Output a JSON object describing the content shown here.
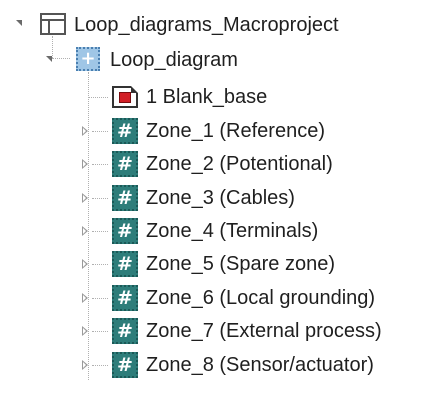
{
  "tree": {
    "root": {
      "label": "Loop_diagrams_Macroproject",
      "icon": "window-icon"
    },
    "child": {
      "label": "Loop_diagram",
      "icon": "plus-folder-icon",
      "icon_glyph": "+"
    },
    "items": [
      {
        "label": "1 Blank_base",
        "icon": "document-icon",
        "expandable": false
      },
      {
        "label": "Zone_1 (Reference)",
        "icon": "hash-icon",
        "expandable": true
      },
      {
        "label": "Zone_2 (Potentional)",
        "icon": "hash-icon",
        "expandable": true
      },
      {
        "label": "Zone_3 (Cables)",
        "icon": "hash-icon",
        "expandable": true
      },
      {
        "label": "Zone_4 (Terminals)",
        "icon": "hash-icon",
        "expandable": true
      },
      {
        "label": "Zone_5 (Spare zone)",
        "icon": "hash-icon",
        "expandable": true
      },
      {
        "label": "Zone_6 (Local grounding)",
        "icon": "hash-icon",
        "expandable": true
      },
      {
        "label": "Zone_7 (External process)",
        "icon": "hash-icon",
        "expandable": true
      },
      {
        "label": "Zone_8 (Sensor/actuator)",
        "icon": "hash-icon",
        "expandable": true
      }
    ],
    "hash_glyph": "#"
  },
  "colors": {
    "hash_icon_bg": "#2e7d7a",
    "plus_icon_bg": "#9fc6e6",
    "doc_icon_red": "#d21f26"
  }
}
